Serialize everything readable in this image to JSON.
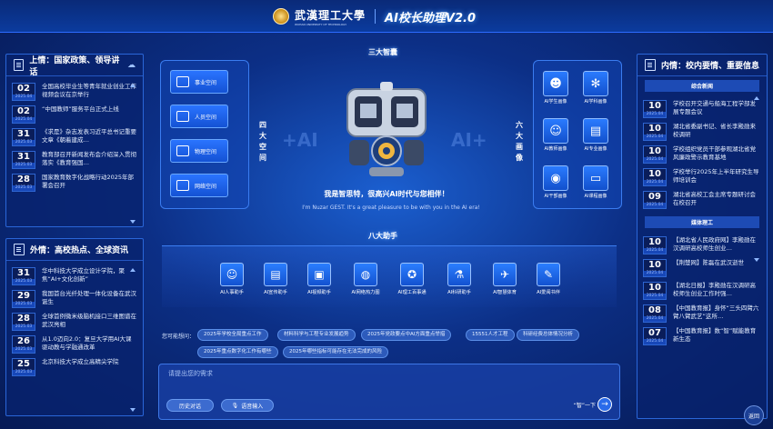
{
  "header": {
    "school_name": "武漢理工大學",
    "school_en": "WUHAN UNIVERSITY OF TECHNOLOGY",
    "app_title": "AI校长助理V2.0"
  },
  "left_top": {
    "title": "上情：国家政策、领导讲话",
    "items": [
      {
        "day": "02",
        "ym": "2025.04",
        "text": "全国高校毕业生等青年就业创业工作视频会议在京举行"
      },
      {
        "day": "02",
        "ym": "2025.04",
        "text": "“中国教师”服务平台正式上线"
      },
      {
        "day": "31",
        "ym": "2025.03",
        "text": "《求是》杂志发表习近平总书记重要文章《朝着建成…"
      },
      {
        "day": "31",
        "ym": "2025.03",
        "text": "教育部召开新闻发布会介绍深入贯彻落实《教育强国…"
      },
      {
        "day": "28",
        "ym": "2025.03",
        "text": "国家教育数字化战略行动2025年部署会召开"
      }
    ]
  },
  "left_bottom": {
    "title": "外情：高校热点、全球资讯",
    "items": [
      {
        "day": "31",
        "ym": "2025.03",
        "text": "华中科技大学成立设计学院，聚焦“AI+文化创新”"
      },
      {
        "day": "29",
        "ym": "2025.03",
        "text": "我国首台光纤处理一体化设备在武汉诞生"
      },
      {
        "day": "28",
        "ym": "2025.03",
        "text": "全球首例微米级脑机接口三维图谱在武汉亮相"
      },
      {
        "day": "26",
        "ym": "2025.03",
        "text": "从1.0迈向2.0：复旦大学用AI大课驱动教与学融通改革"
      },
      {
        "day": "25",
        "ym": "2025.03",
        "text": "北京科技大学成立高精尖学院"
      }
    ]
  },
  "right_panel": {
    "title": "内情：校内要情、重要信息",
    "subhead_1": "综合新闻",
    "items_1": [
      {
        "day": "10",
        "ym": "2025.04",
        "text": "学校召开交通与船海工程学部发展专题会议"
      },
      {
        "day": "10",
        "ym": "2025.04",
        "text": "湖北省委副书记、省长李殿勋来校调研"
      },
      {
        "day": "10",
        "ym": "2025.04",
        "text": "学校组织党员干部参观湖北省党风廉政警示教育基地"
      },
      {
        "day": "10",
        "ym": "2025.04",
        "text": "学校举行2025年上半年研究生导师培训会"
      },
      {
        "day": "09",
        "ym": "2025.04",
        "text": "湖北省高校工会主席专题研讨会在校召开"
      }
    ],
    "subhead_2": "媒体理工",
    "items_2": [
      {
        "day": "10",
        "ym": "2025.04",
        "text": "【湖北省人民政府网】李殿勋在汉调研高校师生创业…"
      },
      {
        "day": "10",
        "ym": "2025.04",
        "text": "【荆楚网】陈磊在武汉逝世"
      },
      {
        "day": "10",
        "ym": "2025.04",
        "text": "【湖北日报】李殿勋在汉调研高校师生创业工作时强…"
      },
      {
        "day": "08",
        "ym": "2025.04",
        "text": "【中国教育报】身怀“三头四臂六臂八臂武艺”这所…"
      },
      {
        "day": "07",
        "ym": "2025.04",
        "text": "【中国教育报】数“智”赋能教育新生态"
      }
    ]
  },
  "center": {
    "three_wisdom": "三大智囊",
    "four_space_label": "四大空间",
    "six_portrait_label": "六大画像",
    "spaces": [
      "事业空间",
      "人员空间",
      "物理空间",
      "网络空间"
    ],
    "portraits": [
      "AI学生画像",
      "AI学科画像",
      "AI教师画像",
      "AI专业画像",
      "AI干部画像",
      "AI课程画像"
    ],
    "ai_left": "+AI",
    "ai_right": "AI+",
    "greeting_cn": "我是智思特，很高兴AI时代与您相伴！",
    "greeting_en": "I'm Nuzar GEST. It's a great pleasure to be with you in the AI era!",
    "eight_assistants": "八大助手",
    "assistants": [
      "AI人事助手",
      "AI宣传助手",
      "AI视频助手",
      "AI网络热力图",
      "AI理工百事通",
      "AI科研助手",
      "AI智慧体育",
      "AI爱阅书伴"
    ],
    "maybe_label": "您可能想问：",
    "chips": [
      "2025年学校全局重点工作",
      "材料科学与工程专业发展趋势",
      "2025年党政要点中AI方面重点举措",
      "15551人才工程",
      "科研经费总体情况分析",
      "2025年重点数字化工作有哪些",
      "2025年哪些指标可能存在无法完成的风险"
    ],
    "input_placeholder": "请提出您的需求",
    "history_btn": "历史对话",
    "voice_btn": "语音输入",
    "send_label": "“智”一下",
    "send_icon": "→",
    "corner_label": "返回"
  },
  "colors": {
    "accent": "#2a74ff",
    "bg": "#0c2f86"
  }
}
